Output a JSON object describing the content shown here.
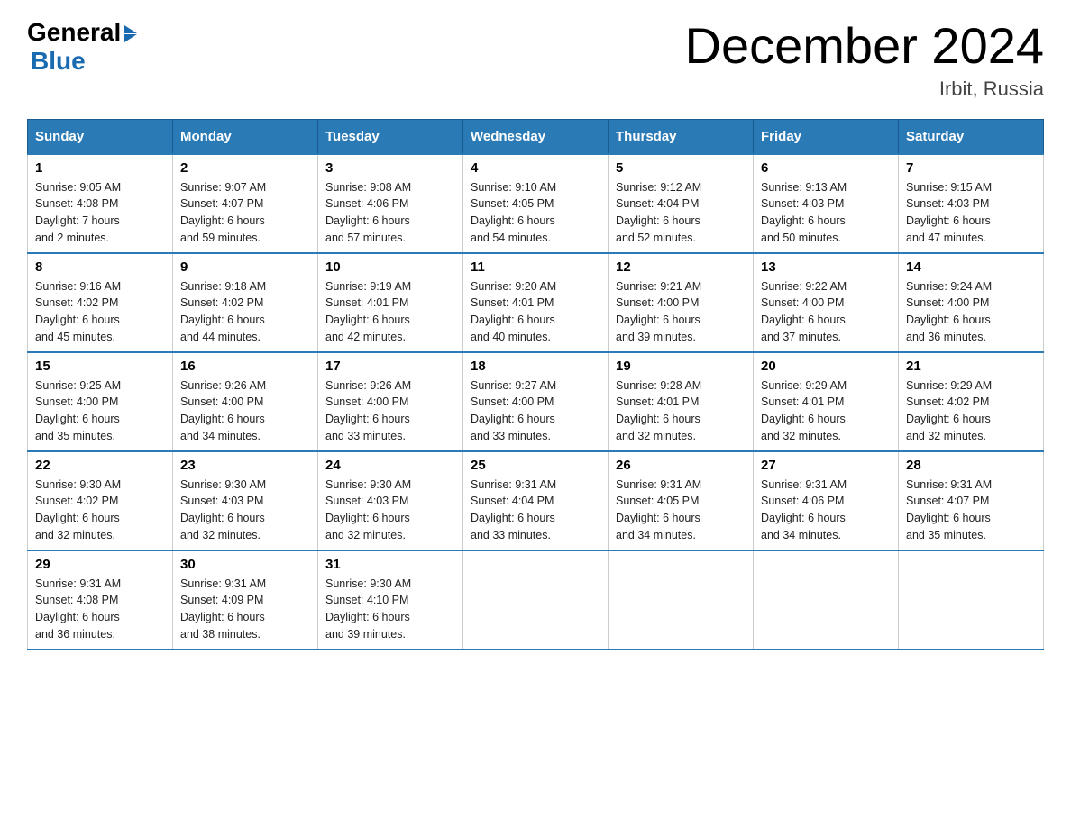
{
  "header": {
    "logo_general": "General",
    "logo_blue": "Blue",
    "month_title": "December 2024",
    "location": "Irbit, Russia"
  },
  "weekdays": [
    "Sunday",
    "Monday",
    "Tuesday",
    "Wednesday",
    "Thursday",
    "Friday",
    "Saturday"
  ],
  "weeks": [
    [
      {
        "day": "1",
        "sunrise": "9:05 AM",
        "sunset": "4:08 PM",
        "daylight": "7 hours and 2 minutes."
      },
      {
        "day": "2",
        "sunrise": "9:07 AM",
        "sunset": "4:07 PM",
        "daylight": "6 hours and 59 minutes."
      },
      {
        "day": "3",
        "sunrise": "9:08 AM",
        "sunset": "4:06 PM",
        "daylight": "6 hours and 57 minutes."
      },
      {
        "day": "4",
        "sunrise": "9:10 AM",
        "sunset": "4:05 PM",
        "daylight": "6 hours and 54 minutes."
      },
      {
        "day": "5",
        "sunrise": "9:12 AM",
        "sunset": "4:04 PM",
        "daylight": "6 hours and 52 minutes."
      },
      {
        "day": "6",
        "sunrise": "9:13 AM",
        "sunset": "4:03 PM",
        "daylight": "6 hours and 50 minutes."
      },
      {
        "day": "7",
        "sunrise": "9:15 AM",
        "sunset": "4:03 PM",
        "daylight": "6 hours and 47 minutes."
      }
    ],
    [
      {
        "day": "8",
        "sunrise": "9:16 AM",
        "sunset": "4:02 PM",
        "daylight": "6 hours and 45 minutes."
      },
      {
        "day": "9",
        "sunrise": "9:18 AM",
        "sunset": "4:02 PM",
        "daylight": "6 hours and 44 minutes."
      },
      {
        "day": "10",
        "sunrise": "9:19 AM",
        "sunset": "4:01 PM",
        "daylight": "6 hours and 42 minutes."
      },
      {
        "day": "11",
        "sunrise": "9:20 AM",
        "sunset": "4:01 PM",
        "daylight": "6 hours and 40 minutes."
      },
      {
        "day": "12",
        "sunrise": "9:21 AM",
        "sunset": "4:00 PM",
        "daylight": "6 hours and 39 minutes."
      },
      {
        "day": "13",
        "sunrise": "9:22 AM",
        "sunset": "4:00 PM",
        "daylight": "6 hours and 37 minutes."
      },
      {
        "day": "14",
        "sunrise": "9:24 AM",
        "sunset": "4:00 PM",
        "daylight": "6 hours and 36 minutes."
      }
    ],
    [
      {
        "day": "15",
        "sunrise": "9:25 AM",
        "sunset": "4:00 PM",
        "daylight": "6 hours and 35 minutes."
      },
      {
        "day": "16",
        "sunrise": "9:26 AM",
        "sunset": "4:00 PM",
        "daylight": "6 hours and 34 minutes."
      },
      {
        "day": "17",
        "sunrise": "9:26 AM",
        "sunset": "4:00 PM",
        "daylight": "6 hours and 33 minutes."
      },
      {
        "day": "18",
        "sunrise": "9:27 AM",
        "sunset": "4:00 PM",
        "daylight": "6 hours and 33 minutes."
      },
      {
        "day": "19",
        "sunrise": "9:28 AM",
        "sunset": "4:01 PM",
        "daylight": "6 hours and 32 minutes."
      },
      {
        "day": "20",
        "sunrise": "9:29 AM",
        "sunset": "4:01 PM",
        "daylight": "6 hours and 32 minutes."
      },
      {
        "day": "21",
        "sunrise": "9:29 AM",
        "sunset": "4:02 PM",
        "daylight": "6 hours and 32 minutes."
      }
    ],
    [
      {
        "day": "22",
        "sunrise": "9:30 AM",
        "sunset": "4:02 PM",
        "daylight": "6 hours and 32 minutes."
      },
      {
        "day": "23",
        "sunrise": "9:30 AM",
        "sunset": "4:03 PM",
        "daylight": "6 hours and 32 minutes."
      },
      {
        "day": "24",
        "sunrise": "9:30 AM",
        "sunset": "4:03 PM",
        "daylight": "6 hours and 32 minutes."
      },
      {
        "day": "25",
        "sunrise": "9:31 AM",
        "sunset": "4:04 PM",
        "daylight": "6 hours and 33 minutes."
      },
      {
        "day": "26",
        "sunrise": "9:31 AM",
        "sunset": "4:05 PM",
        "daylight": "6 hours and 34 minutes."
      },
      {
        "day": "27",
        "sunrise": "9:31 AM",
        "sunset": "4:06 PM",
        "daylight": "6 hours and 34 minutes."
      },
      {
        "day": "28",
        "sunrise": "9:31 AM",
        "sunset": "4:07 PM",
        "daylight": "6 hours and 35 minutes."
      }
    ],
    [
      {
        "day": "29",
        "sunrise": "9:31 AM",
        "sunset": "4:08 PM",
        "daylight": "6 hours and 36 minutes."
      },
      {
        "day": "30",
        "sunrise": "9:31 AM",
        "sunset": "4:09 PM",
        "daylight": "6 hours and 38 minutes."
      },
      {
        "day": "31",
        "sunrise": "9:30 AM",
        "sunset": "4:10 PM",
        "daylight": "6 hours and 39 minutes."
      },
      null,
      null,
      null,
      null
    ]
  ],
  "labels": {
    "sunrise": "Sunrise:",
    "sunset": "Sunset:",
    "daylight": "Daylight:"
  }
}
